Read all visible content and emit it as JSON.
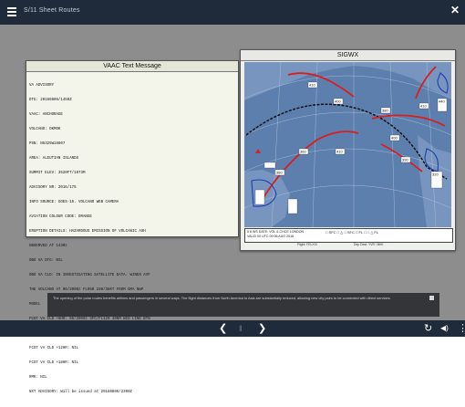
{
  "app": {
    "title": "S/11 Sheet Routes"
  },
  "vaac": {
    "title": "VAAC Text Message",
    "lines": [
      "VA ADVISORY",
      "DTG: 20160806/1450Z",
      "VAAC: ANCHORAGE",
      "VOLCANO: OKMOK",
      "PSN: N5325W16807",
      "AREA: ALEUTIAN ISLANDS",
      "SUMMIT ELEV: 3520FT/1073M",
      "ADVISORY NR: 2016/175",
      "INFO SOURCE: GOES-15. VOLCANO WEB CAMERA",
      "AVIATION COLOUR CODE: ORANGE",
      "ERUPTION DETAILS: HAZARDOUS EMISSION OF VOLCANIC ASH",
      "OBSERVED AT 1430z",
      "OBS VA DTG: NIL",
      "OBS VA CLD: IN INVESTIGATING SATELLITE DATA. WINDS AVF",
      "THE VOLCANO AT 06/2000z FL050 230/36KT FROM GMA NWP",
      "MODEL",
      "FCST VA CLD +6HR: 06/2000z SFC/FL120 40NM WID LINE BTN",
      "N5325W16807 and N5330W16730",
      "FCST VA CLD +12HR: NIL",
      "FCST VA CLD +18HR: NIL",
      "RMK: NIL",
      "NXT ADVISORY: Will be issued at 20160806/2300Z"
    ]
  },
  "sigwx": {
    "title": "SIGWX",
    "labels": [
      "410",
      "400",
      "380",
      "410",
      "360",
      "380",
      "410",
      "400",
      "390",
      "440",
      "320"
    ],
    "legend_line1": "0 6 WS DATE:  VOL & CHCE LONDON",
    "legend_line2": "VALID 00 UTC 09 06 AUG 2016",
    "legend_symbols": "□ SFC  □ △  □ SFC  □ FL  □  □ △  FL",
    "footer_flight": "Flight: FELXXI",
    "footer_dep": "Dep Dest: YVR / BKK"
  },
  "caption": {
    "text": "The opening of the polar routes benefits airlines and passengers in several ways. The flight distances from North America to Asia are substantially reduced, allowing new city pairs to be connected with direct services."
  },
  "controls": {
    "prev": "❮",
    "pause": "‖",
    "next": "❯",
    "replay": "↻",
    "volume": "◀)",
    "more": "⋮",
    "close": "✕",
    "menu": "menu"
  },
  "colors": {
    "topbar": "#1f2a3a",
    "content_bg": "#8d8d8d",
    "jet_red": "#d81e1e",
    "tropopause_blue": "#1b3fb0",
    "map_blue": "#3a5e99"
  }
}
